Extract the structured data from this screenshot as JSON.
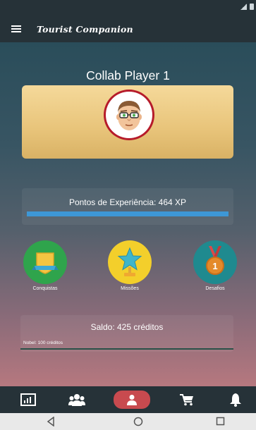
{
  "app": {
    "title": "Tourist Companion",
    "player_name": "Collab Player 1"
  },
  "xp": {
    "label": "Pontos de Experiência: 464 XP",
    "progress_fraction": 1.0
  },
  "badges": [
    {
      "label": "Conquistas",
      "icon": "shield-trophy-icon",
      "color": "#2fa44c"
    },
    {
      "label": "Missões",
      "icon": "star-trophy-icon",
      "color": "#f3cf2b"
    },
    {
      "label": "Desafios",
      "icon": "medal-icon",
      "color": "#1f8a8f"
    }
  ],
  "balance": {
    "label": "Saldo: 425 créditos",
    "level": "Nobel: 100 créditos"
  },
  "bottom_nav": [
    {
      "icon": "stats-icon",
      "active": false
    },
    {
      "icon": "group-icon",
      "active": false
    },
    {
      "icon": "person-icon",
      "active": true
    },
    {
      "icon": "cart-icon",
      "active": false
    },
    {
      "icon": "bell-icon",
      "active": false
    }
  ],
  "colors": {
    "appbar": "#263238",
    "accent_blue": "#3d97d6",
    "active_nav": "#c84a4f"
  }
}
